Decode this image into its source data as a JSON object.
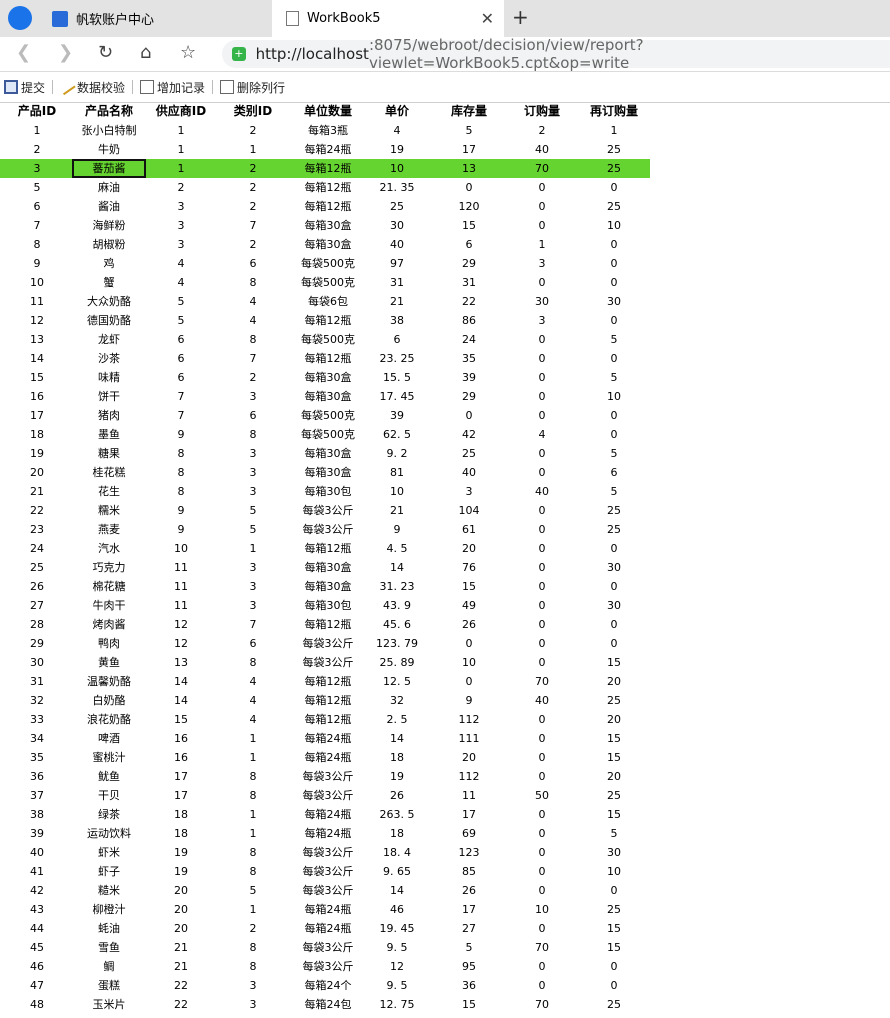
{
  "browser": {
    "tabs": [
      {
        "label": "帆软账户中心"
      },
      {
        "label": "WorkBook5"
      }
    ],
    "url_host": "http://localhost",
    "url_rest": ":8075/webroot/decision/view/report?viewlet=WorkBook5.cpt&op=write"
  },
  "toolbar": {
    "submit": "提交",
    "validate": "数据校验",
    "add_record": "增加记录",
    "delete_row": "删除列行"
  },
  "table": {
    "headers": [
      "产品ID",
      "产品名称",
      "供应商ID",
      "类别ID",
      "单位数量",
      "单价",
      "库存量",
      "订购量",
      "再订购量"
    ],
    "selected_row_index": 2,
    "rows": [
      [
        "1",
        "张小白特制",
        "1",
        "2",
        "每箱3瓶",
        "4",
        "5",
        "2",
        "1"
      ],
      [
        "2",
        "牛奶",
        "1",
        "1",
        "每箱24瓶",
        "19",
        "17",
        "40",
        "25"
      ],
      [
        "3",
        "蕃茄酱",
        "1",
        "2",
        "每箱12瓶",
        "10",
        "13",
        "70",
        "25"
      ],
      [
        "5",
        "麻油",
        "2",
        "2",
        "每箱12瓶",
        "21. 35",
        "0",
        "0",
        "0"
      ],
      [
        "6",
        "酱油",
        "3",
        "2",
        "每箱12瓶",
        "25",
        "120",
        "0",
        "25"
      ],
      [
        "7",
        "海鲜粉",
        "3",
        "7",
        "每箱30盒",
        "30",
        "15",
        "0",
        "10"
      ],
      [
        "8",
        "胡椒粉",
        "3",
        "2",
        "每箱30盒",
        "40",
        "6",
        "1",
        "0"
      ],
      [
        "9",
        "鸡",
        "4",
        "6",
        "每袋500克",
        "97",
        "29",
        "3",
        "0"
      ],
      [
        "10",
        "蟹",
        "4",
        "8",
        "每袋500克",
        "31",
        "31",
        "0",
        "0"
      ],
      [
        "11",
        "大众奶酪",
        "5",
        "4",
        "每袋6包",
        "21",
        "22",
        "30",
        "30"
      ],
      [
        "12",
        "德国奶酪",
        "5",
        "4",
        "每箱12瓶",
        "38",
        "86",
        "3",
        "0"
      ],
      [
        "13",
        "龙虾",
        "6",
        "8",
        "每袋500克",
        "6",
        "24",
        "0",
        "5"
      ],
      [
        "14",
        "沙茶",
        "6",
        "7",
        "每箱12瓶",
        "23. 25",
        "35",
        "0",
        "0"
      ],
      [
        "15",
        "味精",
        "6",
        "2",
        "每箱30盒",
        "15. 5",
        "39",
        "0",
        "5"
      ],
      [
        "16",
        "饼干",
        "7",
        "3",
        "每箱30盒",
        "17. 45",
        "29",
        "0",
        "10"
      ],
      [
        "17",
        "猪肉",
        "7",
        "6",
        "每袋500克",
        "39",
        "0",
        "0",
        "0"
      ],
      [
        "18",
        "墨鱼",
        "9",
        "8",
        "每袋500克",
        "62. 5",
        "42",
        "4",
        "0"
      ],
      [
        "19",
        "糖果",
        "8",
        "3",
        "每箱30盒",
        "9. 2",
        "25",
        "0",
        "5"
      ],
      [
        "20",
        "桂花糕",
        "8",
        "3",
        "每箱30盒",
        "81",
        "40",
        "0",
        "6"
      ],
      [
        "21",
        "花生",
        "8",
        "3",
        "每箱30包",
        "10",
        "3",
        "40",
        "5"
      ],
      [
        "22",
        "糯米",
        "9",
        "5",
        "每袋3公斤",
        "21",
        "104",
        "0",
        "25"
      ],
      [
        "23",
        "燕麦",
        "9",
        "5",
        "每袋3公斤",
        "9",
        "61",
        "0",
        "25"
      ],
      [
        "24",
        "汽水",
        "10",
        "1",
        "每箱12瓶",
        "4. 5",
        "20",
        "0",
        "0"
      ],
      [
        "25",
        "巧克力",
        "11",
        "3",
        "每箱30盒",
        "14",
        "76",
        "0",
        "30"
      ],
      [
        "26",
        "棉花糖",
        "11",
        "3",
        "每箱30盒",
        "31. 23",
        "15",
        "0",
        "0"
      ],
      [
        "27",
        "牛肉干",
        "11",
        "3",
        "每箱30包",
        "43. 9",
        "49",
        "0",
        "30"
      ],
      [
        "28",
        "烤肉酱",
        "12",
        "7",
        "每箱12瓶",
        "45. 6",
        "26",
        "0",
        "0"
      ],
      [
        "29",
        "鸭肉",
        "12",
        "6",
        "每袋3公斤",
        "123. 79",
        "0",
        "0",
        "0"
      ],
      [
        "30",
        "黄鱼",
        "13",
        "8",
        "每袋3公斤",
        "25. 89",
        "10",
        "0",
        "15"
      ],
      [
        "31",
        "温馨奶酪",
        "14",
        "4",
        "每箱12瓶",
        "12. 5",
        "0",
        "70",
        "20"
      ],
      [
        "32",
        "白奶酪",
        "14",
        "4",
        "每箱12瓶",
        "32",
        "9",
        "40",
        "25"
      ],
      [
        "33",
        "浪花奶酪",
        "15",
        "4",
        "每箱12瓶",
        "2. 5",
        "112",
        "0",
        "20"
      ],
      [
        "34",
        "啤酒",
        "16",
        "1",
        "每箱24瓶",
        "14",
        "111",
        "0",
        "15"
      ],
      [
        "35",
        "蜜桃汁",
        "16",
        "1",
        "每箱24瓶",
        "18",
        "20",
        "0",
        "15"
      ],
      [
        "36",
        "鱿鱼",
        "17",
        "8",
        "每袋3公斤",
        "19",
        "112",
        "0",
        "20"
      ],
      [
        "37",
        "干贝",
        "17",
        "8",
        "每袋3公斤",
        "26",
        "11",
        "50",
        "25"
      ],
      [
        "38",
        "绿茶",
        "18",
        "1",
        "每箱24瓶",
        "263. 5",
        "17",
        "0",
        "15"
      ],
      [
        "39",
        "运动饮料",
        "18",
        "1",
        "每箱24瓶",
        "18",
        "69",
        "0",
        "5"
      ],
      [
        "40",
        "虾米",
        "19",
        "8",
        "每袋3公斤",
        "18. 4",
        "123",
        "0",
        "30"
      ],
      [
        "41",
        "虾子",
        "19",
        "8",
        "每袋3公斤",
        "9. 65",
        "85",
        "0",
        "10"
      ],
      [
        "42",
        "糙米",
        "20",
        "5",
        "每袋3公斤",
        "14",
        "26",
        "0",
        "0"
      ],
      [
        "43",
        "柳橙汁",
        "20",
        "1",
        "每箱24瓶",
        "46",
        "17",
        "10",
        "25"
      ],
      [
        "44",
        "蚝油",
        "20",
        "2",
        "每箱24瓶",
        "19. 45",
        "27",
        "0",
        "15"
      ],
      [
        "45",
        "雪鱼",
        "21",
        "8",
        "每袋3公斤",
        "9. 5",
        "5",
        "70",
        "15"
      ],
      [
        "46",
        "鲷",
        "21",
        "8",
        "每袋3公斤",
        "12",
        "95",
        "0",
        "0"
      ],
      [
        "47",
        "蛋糕",
        "22",
        "3",
        "每箱24个",
        "9. 5",
        "36",
        "0",
        "0"
      ],
      [
        "48",
        "玉米片",
        "22",
        "3",
        "每箱24包",
        "12. 75",
        "15",
        "70",
        "25"
      ]
    ]
  }
}
